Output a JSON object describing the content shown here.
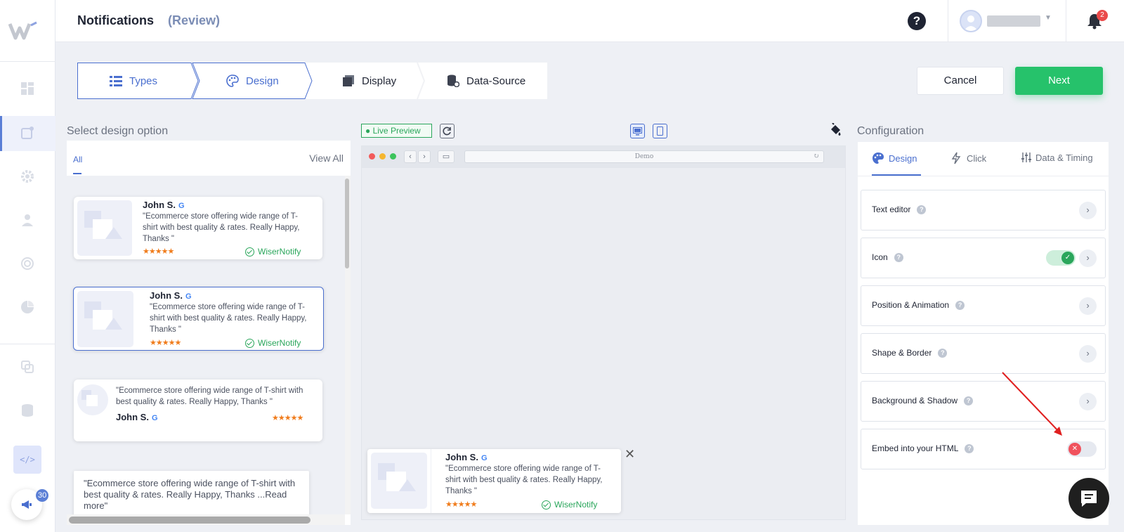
{
  "app": {
    "title": "Notifications",
    "subtitle": "(Review)"
  },
  "header": {
    "help": "?",
    "notification_count": "2"
  },
  "sidebar": {
    "badge_count": "30",
    "code_icon_label": "</>"
  },
  "stepper": {
    "steps": [
      {
        "label": "Types",
        "state": "done"
      },
      {
        "label": "Design",
        "state": "current"
      },
      {
        "label": "Display",
        "state": "pending"
      },
      {
        "label": "Data-Source",
        "state": "pending"
      }
    ]
  },
  "actions": {
    "cancel": "Cancel",
    "next": "Next"
  },
  "design_options": {
    "heading": "Select design option",
    "tab_all": "All",
    "view_all": "View All",
    "cards": [
      {
        "name": "John S.",
        "text": "\"Ecommerce store offering wide range of T-shirt with best quality & rates. Really Happy, Thanks \"",
        "stars": "★★★★★",
        "brand": "WiserNotify"
      },
      {
        "name": "John S.",
        "text": "\"Ecommerce store offering wide range of T-shirt with best quality & rates. Really Happy, Thanks \"",
        "stars": "★★★★★",
        "brand": "WiserNotify"
      },
      {
        "name": "John S.",
        "text": "\"Ecommerce store offering wide range of T-shirt with best quality & rates. Really Happy, Thanks \"",
        "stars": "★★★★★"
      },
      {
        "text": "\"Ecommerce store offering wide range of T-shirt with best quality & rates. Really Happy, Thanks ...Read more\""
      }
    ]
  },
  "preview": {
    "live_label": "Live Preview",
    "url": "Demo",
    "popup": {
      "name": "John S.",
      "text": "\"Ecommerce store offering wide range of T-shirt with best quality & rates. Really Happy, Thanks \"",
      "stars": "★★★★★",
      "brand": "WiserNotify"
    }
  },
  "configuration": {
    "heading": "Configuration",
    "tabs": [
      {
        "label": "Design",
        "icon": "palette-icon"
      },
      {
        "label": "Click",
        "icon": "lightning-icon"
      },
      {
        "label": "Data & Timing",
        "icon": "sliders-icon"
      }
    ],
    "sections": [
      {
        "label": "Text editor"
      },
      {
        "label": "Icon",
        "toggle": "on"
      },
      {
        "label": "Position & Animation"
      },
      {
        "label": "Shape & Border"
      },
      {
        "label": "Background & Shadow"
      },
      {
        "label": "Embed into your HTML",
        "toggle": "off"
      }
    ]
  },
  "colors": {
    "accent": "#4a6fcf",
    "success": "#26c26b",
    "star": "#f07c1c",
    "danger": "#f0525d"
  }
}
